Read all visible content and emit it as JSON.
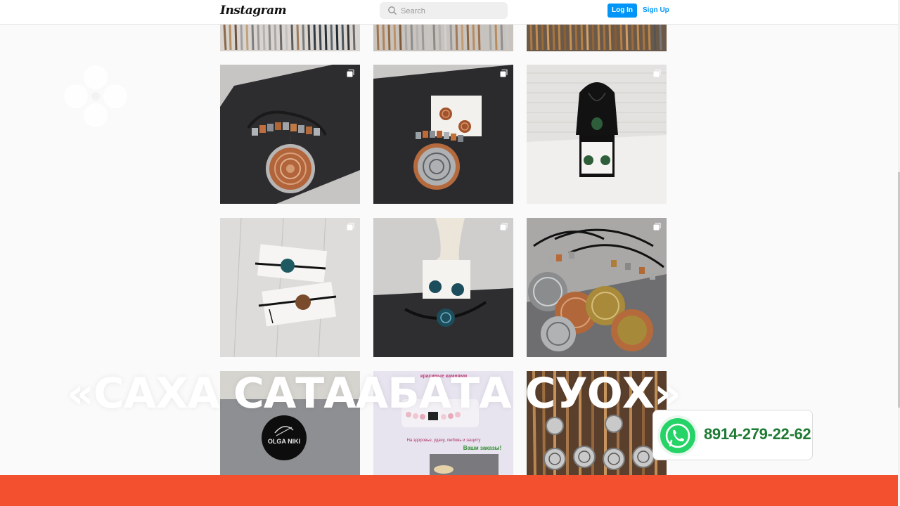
{
  "header": {
    "logo_text": "Instagram",
    "search_placeholder": "Search",
    "login_label": "Log In",
    "signup_label": "Sign Up"
  },
  "grid": {
    "tiles": [
      {
        "id": "r0c0",
        "multi": false
      },
      {
        "id": "r0c1",
        "multi": false
      },
      {
        "id": "r0c2",
        "multi": false
      },
      {
        "id": "r1c0",
        "multi": true
      },
      {
        "id": "r1c1",
        "multi": true
      },
      {
        "id": "r1c2",
        "multi": true
      },
      {
        "id": "r2c0",
        "multi": true
      },
      {
        "id": "r2c1",
        "multi": true
      },
      {
        "id": "r2c2",
        "multi": true
      },
      {
        "id": "r3c0",
        "multi": false,
        "badge_text": "OLGA NIKI"
      },
      {
        "id": "r3c1",
        "multi": false,
        "caption_top": "красивые камнями",
        "caption_mid": "На здоровье, удачу, любовь и защиту",
        "caption_bottom": "Ваши заказы!"
      },
      {
        "id": "r3c2",
        "multi": false
      }
    ]
  },
  "overlay": {
    "title": "«САХА САТААБАТА СУОХ»"
  },
  "contact": {
    "phone": "8914-279-22-62",
    "icon": "whatsapp-icon"
  },
  "colors": {
    "accent": "#0095f6",
    "bottom_bar": "#f2502f",
    "whatsapp_green": "#25d366",
    "phone_text": "#1d7a33"
  }
}
